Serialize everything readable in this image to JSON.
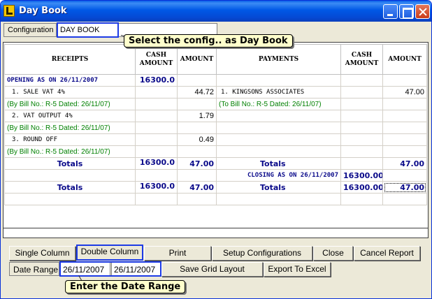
{
  "window": {
    "title": "Day Book",
    "icon": "app-l-icon",
    "controls": [
      "minimize-icon",
      "maximize-icon",
      "close-icon"
    ]
  },
  "config": {
    "label": "Configuration",
    "value": "DAY BOOK"
  },
  "callouts": {
    "config": "Select the config.. as Day Book",
    "date_range": "Enter the Date Range"
  },
  "grid": {
    "headers": {
      "receipts": "RECEIPTS",
      "cash_amount": "CASH AMOUNT",
      "amount": "AMOUNT",
      "payments": "PAYMENTS",
      "cash_amount_2": "CASH AMOUNT",
      "amount_2": "AMOUNT"
    },
    "opening": {
      "label": "OPENING AS ON 26/11/2007",
      "cash": "16300.0"
    },
    "receipts": [
      {
        "label": "1. SALE VAT 4%",
        "amount": "44.72",
        "bill": "(By Bill No.: R-5 Dated: 26/11/07)"
      },
      {
        "label": "2. VAT OUTPUT 4%",
        "amount": "1.79",
        "bill": "(By Bill No.: R-5 Dated: 26/11/07)"
      },
      {
        "label": "3. ROUND OFF",
        "amount": "0.49",
        "bill": "(By Bill No.: R-5 Dated: 26/11/07)"
      }
    ],
    "payments": [
      {
        "label": "1. KINGSONS ASSOCIATES",
        "amount": "47.00",
        "bill": "(To Bill No.: R-5 Dated: 26/11/07)"
      }
    ],
    "totals1": {
      "label_left": "Totals",
      "cash_left": "16300.0",
      "amount_left": "47.00",
      "label_right": "Totals",
      "amount_right": "47.00"
    },
    "closing": {
      "label": "CLOSING AS ON 26/11/2007",
      "cash": "16300.00"
    },
    "totals2": {
      "label_left": "Totals",
      "cash_left": "16300.0",
      "amount_left": "47.00",
      "label_right": "Totals",
      "cash_right": "16300.00",
      "amount_right": "47.00"
    }
  },
  "buttons": {
    "single_column": "Single Column",
    "double_column": "Double Column",
    "print": "Print",
    "setup_configurations": "Setup Configurations",
    "close": "Close",
    "cancel_report": "Cancel Report",
    "save_grid_layout": "Save Grid Layout",
    "export_to_excel": "Export To Excel"
  },
  "date_range": {
    "label": "Date Range",
    "from": "26/11/2007",
    "to": "26/11/2007"
  },
  "colors": {
    "titlebar": "#0058e6",
    "highlight_border": "#1d3be6",
    "totals_text": "#0a0a8a",
    "bill_text": "#008000",
    "callout_bg": "#ffffcc"
  }
}
